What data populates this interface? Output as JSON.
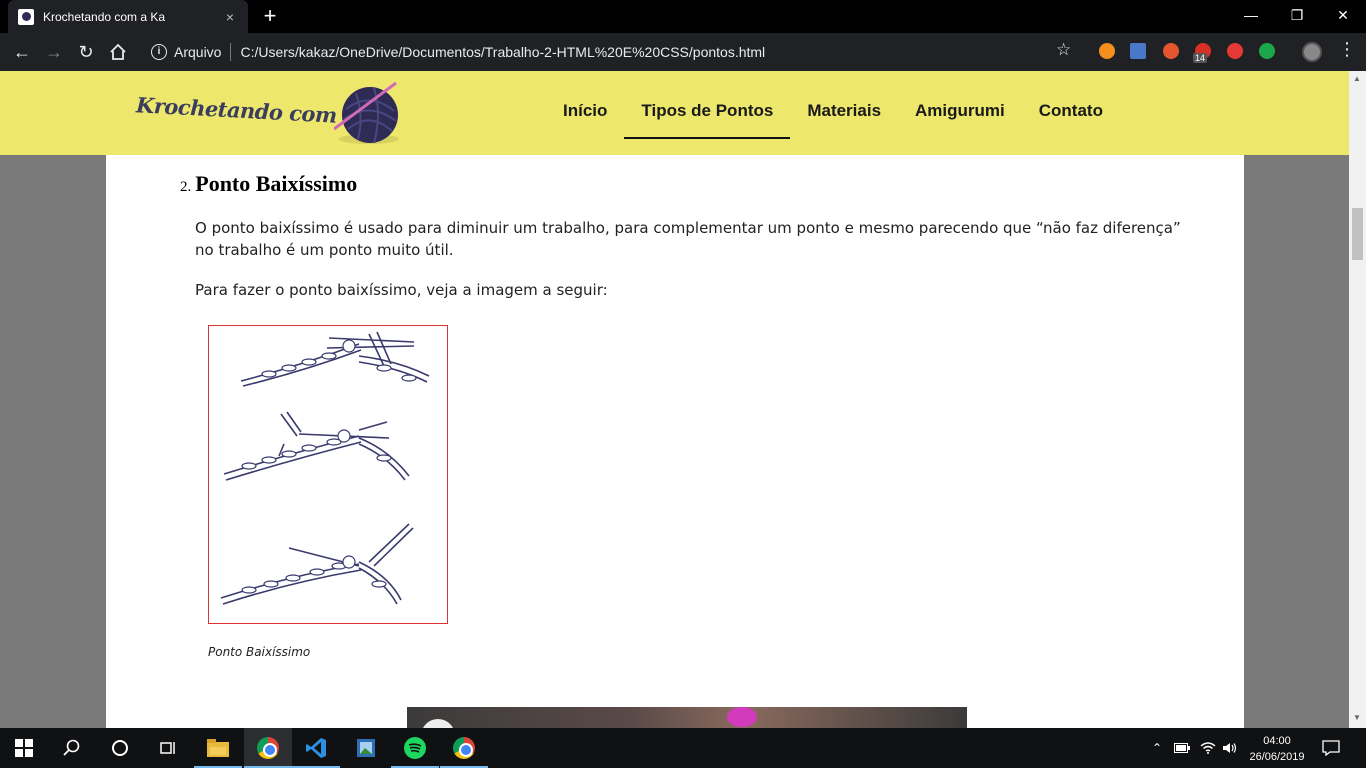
{
  "browser": {
    "tab_title": "Krochetando com a Ka",
    "tab_close": "×",
    "new_tab": "+",
    "window_controls": [
      "—",
      "❐",
      "✕"
    ],
    "address_prefix": "Arquivo",
    "address_url": "C:/Users/kakaz/OneDrive/Documentos/Trabalho-2-HTML%20E%20CSS/pontos.html",
    "extension_badge": "14"
  },
  "site": {
    "logo_text": "Krochetando com a Ka",
    "nav": [
      {
        "label": "Início",
        "active": false
      },
      {
        "label": "Tipos de Pontos",
        "active": true
      },
      {
        "label": "Materiais",
        "active": false
      },
      {
        "label": "Amigurumi",
        "active": false
      },
      {
        "label": "Contato",
        "active": false
      }
    ],
    "header_color": "#ede76c"
  },
  "content": {
    "list_number": "2.",
    "heading": "Ponto Baixíssimo",
    "paragraph_1": "O ponto baixíssimo é usado para diminuir um trabalho, para complementar um ponto e mesmo parecendo que “não faz diferença” no trabalho é um ponto muito útil.",
    "paragraph_2": "Para fazer o ponto baixíssimo, veja a imagem a seguir:",
    "figure_caption": "Ponto Baixíssimo"
  },
  "taskbar": {
    "time": "04:00",
    "date": "26/06/2019"
  }
}
